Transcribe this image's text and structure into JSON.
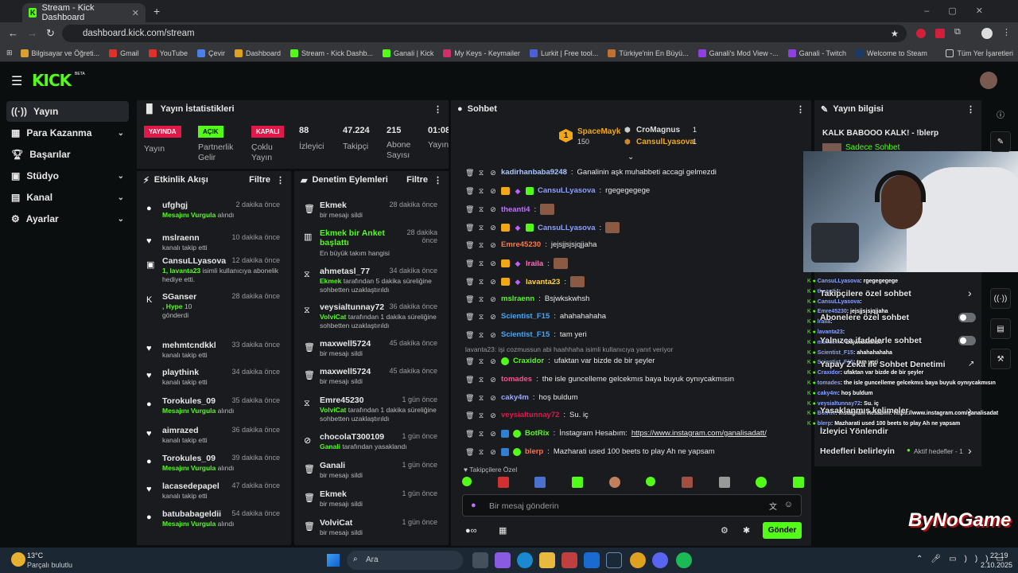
{
  "browser": {
    "tab_title": "Stream - Kick Dashboard",
    "url": "dashboard.kick.com/stream",
    "bookmarks": [
      "Bilgisayar ve Öğreti...",
      "Gmail",
      "YouTube",
      "Çevir",
      "Dashboard",
      "Stream - Kick Dashb...",
      "Ganali | Kick",
      "My Keys - Keymailer",
      "Lurkit | Free tool...",
      "Türkiye'nin En Büyü...",
      "Ganali's Mod View -...",
      "Ganali - Twitch",
      "Welcome to Steam"
    ],
    "all_bookmarks": "Tüm Yer İşaretleri"
  },
  "brand": {
    "logo": "KICK",
    "beta": "BETA"
  },
  "sidebar": [
    {
      "label": "Yayın",
      "icon": "broadcast-icon"
    },
    {
      "label": "Para Kazanma",
      "icon": "money-icon"
    },
    {
      "label": "Başarılar",
      "icon": "trophy-icon"
    },
    {
      "label": "Stüdyo",
      "icon": "studio-icon"
    },
    {
      "label": "Kanal",
      "icon": "channel-icon"
    },
    {
      "label": "Ayarlar",
      "icon": "gear-icon"
    }
  ],
  "stats": {
    "title": "Yayın İstatistikleri",
    "badges": [
      {
        "text": "YAYINDA",
        "label": "Yayın",
        "color": "#e0194a"
      },
      {
        "text": "AÇIK",
        "label": "Partnerlik Gelir",
        "color": "#53fc18"
      },
      {
        "text": "KAPALI",
        "label": "Çoklu Yayın",
        "color": "#e0194a"
      }
    ],
    "numbers": [
      {
        "value": "88",
        "label": "İzleyici"
      },
      {
        "value": "47.224",
        "label": "Takipçi"
      },
      {
        "value": "215",
        "label": "Abone Sayısı"
      },
      {
        "value": "01:08",
        "label": "Yayın Olduğ"
      }
    ]
  },
  "activity": {
    "title": "Etkinlik Akışı",
    "filter": "Filtre",
    "items": [
      {
        "name": "ufghgj",
        "sub": "Mesajını Vurgula",
        "sub2": "alındı",
        "time": "2 dakika önce",
        "icon": "kick-icon"
      },
      {
        "name": "mslraenn",
        "sub": "kanalı takip etti",
        "time": "10 dakika önce",
        "icon": "heart-icon"
      },
      {
        "name": "CansuLLyasova",
        "sub": "1, lavanta23",
        "sub2": "isimli kullanıcıya abonelik hediye etti.",
        "time": "12 dakika önce",
        "icon": "gift-icon"
      },
      {
        "name": "SGanser",
        "sub": ", Hype",
        "sub2": "10",
        "sub3": "gönderdi",
        "time": "28 dakika önce",
        "icon": "kicks-icon"
      },
      {
        "name": "mehmtcndkkl",
        "sub": "kanalı takip etti",
        "time": "33 dakika önce",
        "icon": "heart-icon"
      },
      {
        "name": "playthink",
        "sub": "kanalı takip etti",
        "time": "34 dakika önce",
        "icon": "heart-icon"
      },
      {
        "name": "Torokules_09",
        "sub": "Mesajını Vurgula",
        "sub2": "alındı",
        "time": "35 dakika önce",
        "icon": "kick-icon"
      },
      {
        "name": "aimrazed",
        "sub": "kanalı takip etti",
        "time": "36 dakika önce",
        "icon": "heart-icon"
      },
      {
        "name": "Torokules_09",
        "sub": "Mesajını Vurgula",
        "sub2": "alındı",
        "time": "39 dakika önce",
        "icon": "kick-icon"
      },
      {
        "name": "lacasedepapel",
        "sub": "kanalı takip etti",
        "time": "47 dakika önce",
        "icon": "heart-icon"
      },
      {
        "name": "batubabageldii",
        "sub": "Mesajını Vurgula",
        "sub2": "alındı",
        "time": "54 dakika önce",
        "icon": "kick-icon"
      }
    ]
  },
  "moderation": {
    "title": "Denetim Eylemleri",
    "filter": "Filtre",
    "items": [
      {
        "name": "Ekmek",
        "sub": "bir mesajı sildi",
        "time": "28 dakika önce",
        "icon": "trash-icon"
      },
      {
        "name": "Ekmek bir Anket başlattı",
        "sub": "En büyük takım hangisi",
        "time": "28 dakika önce",
        "icon": "poll-icon"
      },
      {
        "name": "ahmetasl_77",
        "sub": "Ekmek",
        "sub2": "tarafından 5 dakika süreliğine sohbetten uzaklaştırıldı",
        "time": "34 dakika önce",
        "icon": "timeout-icon"
      },
      {
        "name": "veysialtunnay72",
        "sub": "VolviCat",
        "sub2": "tarafından 1 dakika süreliğine sohbetten uzaklaştırıldı",
        "time": "36 dakika önce",
        "icon": "timeout-icon"
      },
      {
        "name": "maxwell5724",
        "sub": "bir mesajı sildi",
        "time": "45 dakika önce",
        "icon": "trash-icon"
      },
      {
        "name": "maxwell5724",
        "sub": "bir mesajı sildi",
        "time": "45 dakika önce",
        "icon": "trash-icon"
      },
      {
        "name": "Emre45230",
        "sub": "VolviCat",
        "sub2": "tarafından 1 dakika süreliğine sohbetten uzaklaştırıldı",
        "time": "1 gün önce",
        "icon": "timeout-icon"
      },
      {
        "name": "chocolaT300109",
        "sub": "Ganali",
        "sub2": "tarafından yasaklandı",
        "time": "1 gün önce",
        "icon": "ban-icon"
      },
      {
        "name": "Ganali",
        "sub": "bir mesajı sildi",
        "time": "1 gün önce",
        "icon": "trash-icon"
      },
      {
        "name": "Ekmek",
        "sub": "bir mesajı sildi",
        "time": "1 gün önce",
        "icon": "trash-icon"
      },
      {
        "name": "VolviCat",
        "sub": "bir mesajı sildi",
        "time": "1 gün önce",
        "icon": "trash-icon"
      }
    ]
  },
  "chat": {
    "title": "Sohbet",
    "leaderboard": {
      "top": "SpaceMayk",
      "top_count": "150",
      "second": "CroMagnus",
      "second_count": "1",
      "third": "CansulLyasova",
      "third_count": "1",
      "rank": "1"
    },
    "messages": [
      {
        "user": "kadirhanbaba9248",
        "color": "#a9c7ff",
        "text": "Ganalinin aşk muhabbeti accagi gelmezdi"
      },
      {
        "user": "CansuLLyasova",
        "color": "#8aa0ff",
        "text": "rgegegegege",
        "badges": true
      },
      {
        "user": "theanti4",
        "color": "#c070ff",
        "text": "",
        "emote": true
      },
      {
        "user": "CansuLLyasova",
        "color": "#8aa0ff",
        "text": "",
        "badges": true,
        "emote": true
      },
      {
        "user": "Emre45230",
        "color": "#ff7744",
        "text": "jejsjjsjsjqjjaha"
      },
      {
        "user": "lraila",
        "color": "#ff70c0",
        "text": "",
        "crown": true,
        "emote": true
      },
      {
        "user": "lavanta23",
        "color": "#ffd040",
        "text": "",
        "crown": true,
        "emote": true
      },
      {
        "user": "mslraenn",
        "color": "#53fc18",
        "text": "Bsjwkskwhsh"
      },
      {
        "user": "Scientist_F15",
        "color": "#40a8ff",
        "text": "ahahahahaha"
      },
      {
        "user": "Scientist_F15",
        "color": "#40a8ff",
        "text": "tam yeri"
      }
    ],
    "reply_note": "lavanta23: işi cozmussun abi haahhaha isimli kullanıcıya yanıt veriyor",
    "messages2": [
      {
        "user": "Craxidor",
        "color": "#53fc18",
        "text": "ufaktan var bizde de bir şeyler"
      },
      {
        "user": "tomades",
        "color": "#ff5090",
        "text": "the isle guncelleme gelcekmıs baya buyuk oynıycakmısın"
      },
      {
        "user": "caky4m",
        "color": "#9aa8ff",
        "text": "hoş buldum"
      },
      {
        "user": "veysialtunnay72",
        "color": "#e0194a",
        "text": "Su. iç"
      },
      {
        "user": "BotRix",
        "color": "#53fc18",
        "text": "İnstagram Hesabım: ",
        "link": "https://www.instagram.com/ganalisadatt/"
      },
      {
        "user": "blerp",
        "color": "#ff7050",
        "text": "Mazharati used 100 beets to play Ah ne yapsam"
      }
    ],
    "followers_only": "Takipçilere Özel",
    "input_placeholder": "Bir mesaj gönderin",
    "send": "Gönder"
  },
  "stream_info": {
    "title": "Yayın bilgisi",
    "stream_title": "KALK BABOOO KALK! - !blerp",
    "subs_chat": "Sadece Sohbet",
    "settings": [
      {
        "label": "Takipçilere özel sohbet",
        "type": "chevron"
      },
      {
        "label": "Abonelere özel sohbet",
        "type": "toggle"
      },
      {
        "label": "Yalnızca ifadelerle sohbet",
        "type": "toggle"
      },
      {
        "label": "Yapay Zeka ile Sohbet Denetimi",
        "type": "external"
      },
      {
        "label": "Yasaklanmış kelimeler",
        "type": "chevron"
      },
      {
        "label": "İzleyici Yönlendir",
        "type": "none"
      },
      {
        "label": "Hedefleri belirleyin",
        "type": "chevron",
        "extra": "Aktif hedefler - 1"
      }
    ]
  },
  "overlay_chat": [
    {
      "user": "CansuLLyasova",
      "text": ": rgegegegege"
    },
    {
      "user": "theanti4",
      "text": ":"
    },
    {
      "user": "CansuLLyasova",
      "text": ":"
    },
    {
      "user": "Emre45230",
      "text": ": jejsjjsjsjqjjaha"
    },
    {
      "user": "lraila",
      "text": ":"
    },
    {
      "user": "lavanta23",
      "text": ":"
    },
    {
      "user": "mslraenn",
      "text": ": Bsjwkskwhsh"
    },
    {
      "user": "Scientist_F15",
      "text": ": ahahahahaha"
    },
    {
      "user": "Scientist_F15",
      "text": ": tam yeri"
    },
    {
      "user": "Craxidor",
      "text": ": ufaktan var bizde de bir şeyler"
    },
    {
      "user": "tomades",
      "text": ": the isle guncelleme gelcekmıs baya buyuk oynıycakmısın"
    },
    {
      "user": "caky4m",
      "text": ": hoş buldum"
    },
    {
      "user": "veysialtunnay72",
      "text": ": Su. iç"
    },
    {
      "user": "BotRix",
      "text": ": İnstagram Hesabım: https://www.instagram.com/ganalisadatt/"
    },
    {
      "user": "blerp",
      "text": ": Mazharati used 100 beets to play Ah ne yapsam"
    }
  ],
  "watermark": "ByNoGame",
  "taskbar": {
    "weather_temp": "13°C",
    "weather_desc": "Parçalı bulutlu",
    "search": "Ara",
    "time": "22:19",
    "date": "2.10.2025"
  }
}
